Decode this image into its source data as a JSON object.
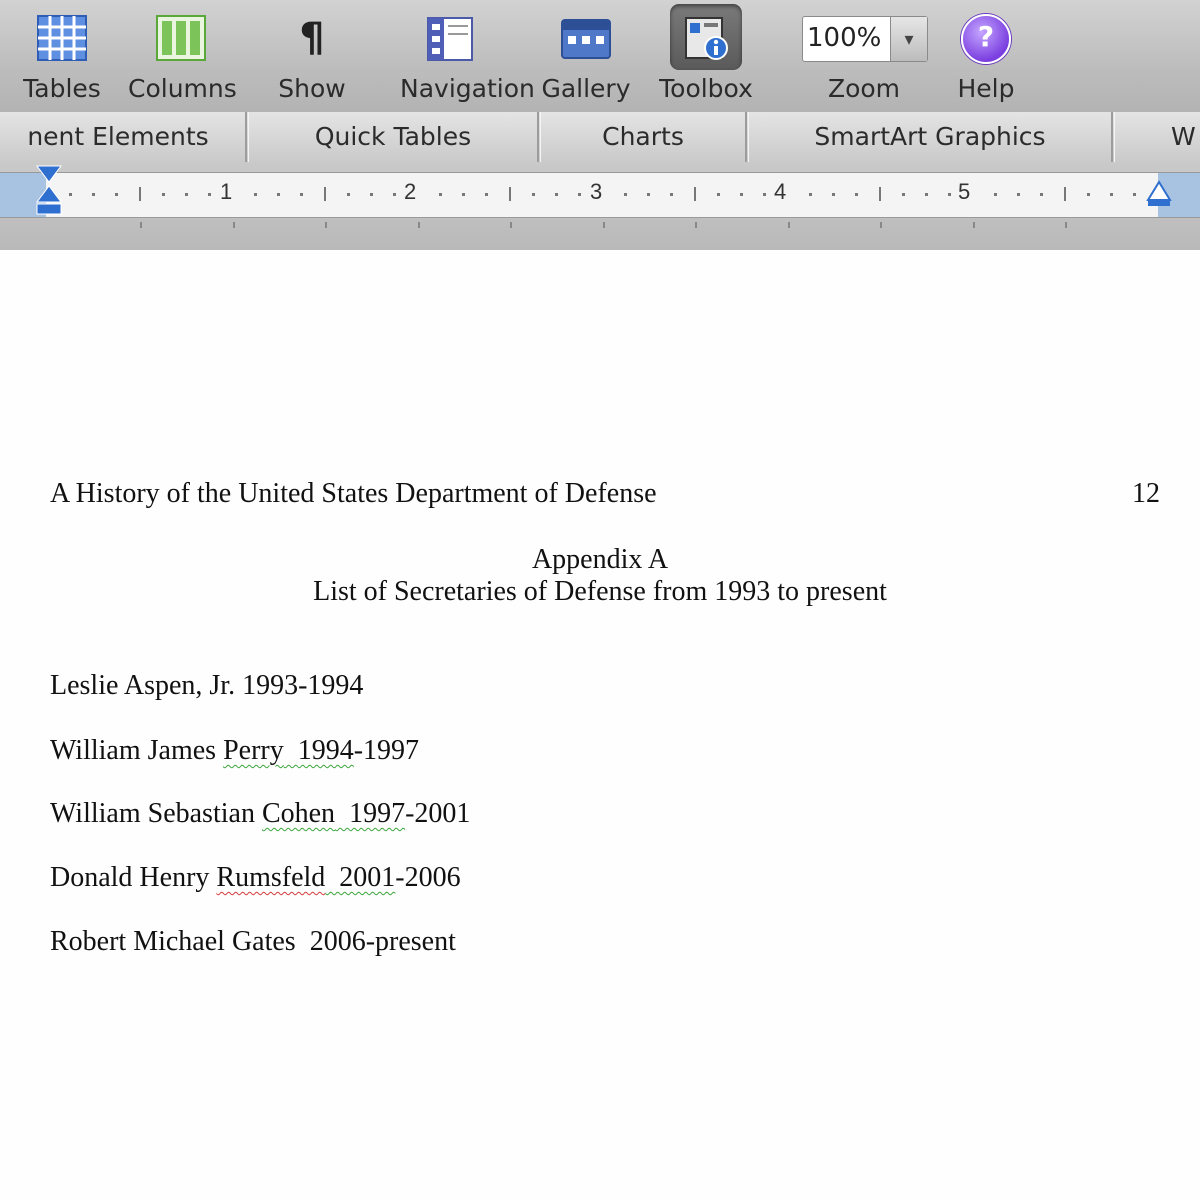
{
  "toolbar": {
    "buttons": [
      {
        "label": "Tables",
        "icon": "table-grid-icon"
      },
      {
        "label": "Columns",
        "icon": "columns-icon"
      },
      {
        "label": "Show",
        "icon": "pilcrow-icon",
        "glyph": "¶"
      },
      {
        "label": "Navigation",
        "icon": "navigation-pane-icon"
      },
      {
        "label": "Gallery",
        "icon": "gallery-icon"
      },
      {
        "label": "Toolbox",
        "icon": "toolbox-icon",
        "active": true
      },
      {
        "label": "Zoom",
        "icon": "zoom-select"
      },
      {
        "label": "Help",
        "icon": "help-icon",
        "glyph": "?"
      }
    ],
    "zoom_value": "100%"
  },
  "ribbon_tabs": [
    "nent Elements",
    "Quick Tables",
    "Charts",
    "SmartArt Graphics",
    "W"
  ],
  "ruler": {
    "numbers": [
      "1",
      "2",
      "3",
      "4",
      "5"
    ]
  },
  "document": {
    "running_head": "A History of the United States Department of Defense",
    "page_number": "12",
    "appendix_title": "Appendix A",
    "appendix_subtitle": "List of Secretaries of Defense from 1993 to present",
    "entries": [
      {
        "pre": "Leslie Aspen, Jr. 1993-1994",
        "flag": "",
        "mid": "",
        "flag2": "",
        "post": ""
      },
      {
        "pre": "William James ",
        "flag": "Perry",
        "mid": "  ",
        "flag2": "1994",
        "post": "-1997"
      },
      {
        "pre": "William Sebastian ",
        "flag": "Cohen",
        "mid": "  ",
        "flag2": "1997",
        "post": "-2001"
      },
      {
        "pre": "Donald Henry ",
        "flag": "Rumsfeld",
        "mid": "  ",
        "flag2": "2001",
        "post": "-2006"
      },
      {
        "pre": "Robert Michael Gates  2006-present",
        "flag": "",
        "mid": "",
        "flag2": "",
        "post": ""
      }
    ]
  },
  "colors": {
    "toolbar_bg": "#c4c4c4",
    "ruler_margin": "#a8c3e2",
    "spell_error": "#d43a3a",
    "grammar_error": "#3aa53a"
  }
}
